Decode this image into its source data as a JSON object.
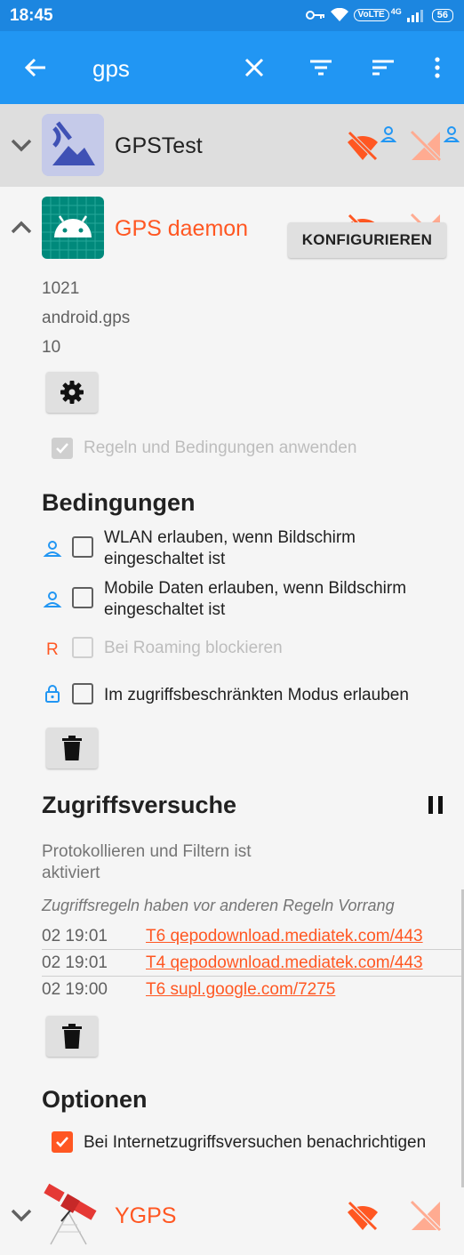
{
  "status_bar": {
    "time": "18:45",
    "network_badge": "VoLTE",
    "network_type": "4G",
    "battery": "56"
  },
  "toolbar": {
    "search_value": "gps",
    "icons": [
      "back-arrow-icon",
      "clear-icon",
      "filter-icon",
      "sort-icon",
      "more-vert-icon"
    ]
  },
  "apps": [
    {
      "name": "GPSTest",
      "expanded": false
    },
    {
      "name": "GPS daemon",
      "expanded": true,
      "uid": "1021",
      "package": "android.gps",
      "version": "10",
      "apply_rules_label": "Regeln und Bedingungen anwenden",
      "conditions": {
        "title": "Bedingungen",
        "wifi_screen_on": "WLAN erlauben, wenn Bildschirm eingeschaltet ist",
        "mobile_screen_on": "Mobile Daten erlauben, wenn Bildschirm eingeschaltet ist",
        "roaming_label_icon": "R",
        "block_roaming": "Bei Roaming blockieren",
        "lockdown": "Im zugriffsbeschränkten Modus erlauben"
      },
      "access": {
        "title": "Zugriffsversuche",
        "logging_status": "Protokollieren und Filtern ist aktiviert",
        "configure_label": "KONFIGURIEREN",
        "precedence_note": "Zugriffsregeln haben vor anderen Regeln Vorrang",
        "attempts": [
          {
            "time": "02 19:01",
            "target": "T6 qepodownload.mediatek.com/443"
          },
          {
            "time": "02 19:01",
            "target": "T4 qepodownload.mediatek.com/443"
          },
          {
            "time": "02 19:00",
            "target": "T6 supl.google.com/7275"
          }
        ]
      },
      "options": {
        "title": "Optionen",
        "notify_label": "Bei Internetzugriffsversuchen benachrichtigen"
      }
    },
    {
      "name": "YGPS",
      "expanded": false
    }
  ],
  "colors": {
    "statusbar": "#1c86e0",
    "toolbar": "#2196f3",
    "accent_orange": "#ff5722",
    "blocked_light": "#ffab91",
    "user_blue": "#2196f3"
  }
}
